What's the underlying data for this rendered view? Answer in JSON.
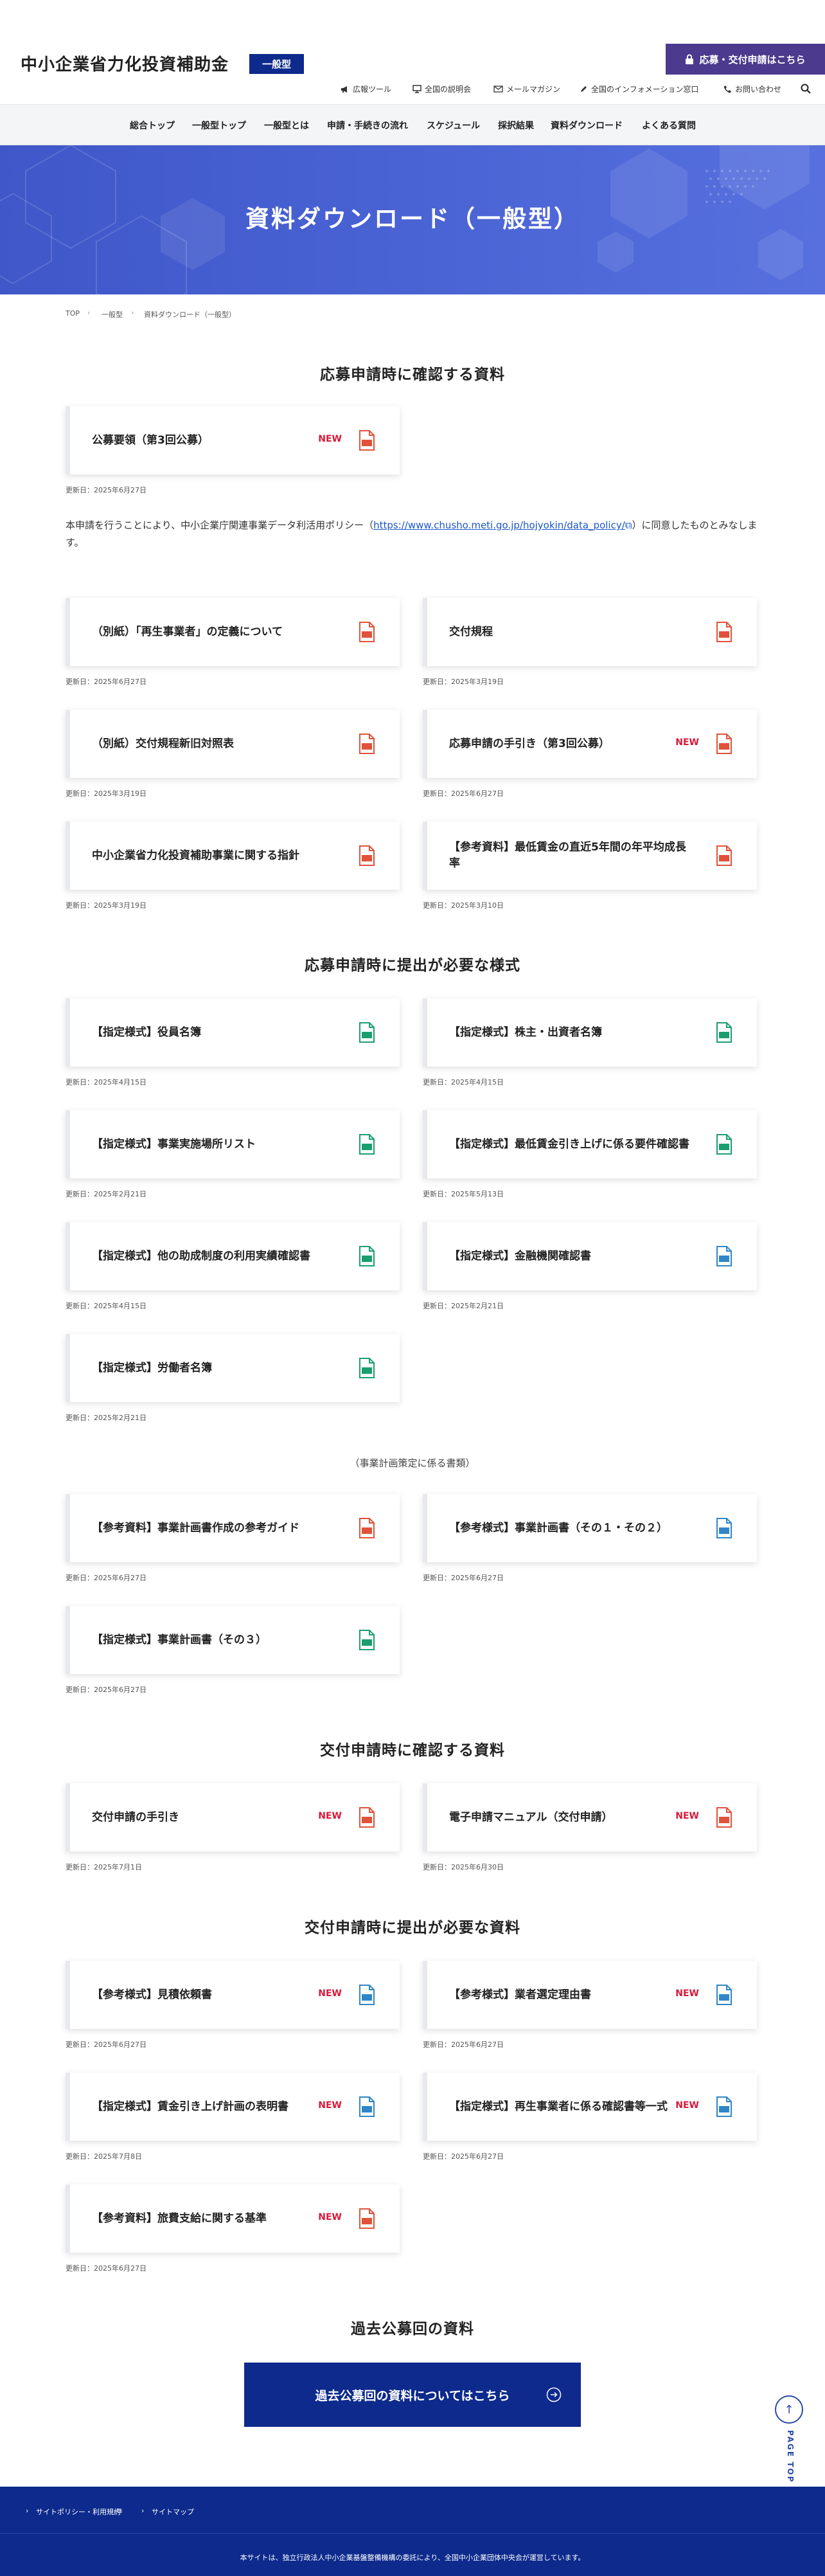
{
  "header": {
    "site_title": "中小企業省力化投資補助金",
    "badge": "一般型",
    "apply_button": "応募・交付申請はこちら",
    "utility": [
      {
        "label": "広報ツール",
        "icon": "megaphone-icon"
      },
      {
        "label": "全国の説明会",
        "icon": "presentation-icon"
      },
      {
        "label": "メールマガジン",
        "icon": "mail-icon"
      },
      {
        "label": "全国のインフォメーション窓口",
        "icon": "pen-icon"
      },
      {
        "label": "お問い合わせ",
        "icon": "phone-icon"
      }
    ],
    "nav": [
      "総合トップ",
      "一般型トップ",
      "一般型とは",
      "申請・手続きの流れ",
      "スケジュール",
      "採択結果",
      "資料ダウンロード",
      "よくある質問"
    ]
  },
  "hero": {
    "title": "資料ダウンロード（一般型）"
  },
  "breadcrumb": [
    "TOP",
    "一般型",
    "資料ダウンロード（一般型）"
  ],
  "colors": {
    "brand": "#0d2a8c",
    "apply": "#4b3a8d",
    "new": "#d8193b",
    "pdf": "#e0523a",
    "excel": "#1a9e6e",
    "word": "#2f86c8",
    "hero": "#4a63d4"
  },
  "new_label": "NEW",
  "sections": [
    {
      "heading": "応募申請時に確認する資料"
    },
    {
      "heading": "応募申請時に提出が必要な様式",
      "subheading": "（事業計画策定に係る書類）"
    },
    {
      "heading": "交付申請時に確認する資料"
    },
    {
      "heading": "交付申請時に提出が必要な資料"
    },
    {
      "heading": "過去公募回の資料"
    }
  ],
  "policy": {
    "before": "本申請を行うことにより、中小企業庁関連事業データ利活用ポリシー（",
    "link": "https://www.chusho.meti.go.jp/hojyokin/data_policy/",
    "after": "）に同意したものとみなします。"
  },
  "cards": [
    {
      "title": "公募要領（第3回公募）",
      "date": "更新日：2025年6月27日",
      "new": true,
      "file": "pdf"
    },
    {
      "title": "（別紙）「再生事業者」の定義について",
      "date": "更新日：2025年6月27日",
      "new": false,
      "file": "pdf"
    },
    {
      "title": "交付規程",
      "date": "更新日：2025年3月19日",
      "new": false,
      "file": "pdf"
    },
    {
      "title": "（別紙）交付規程新旧対照表",
      "date": "更新日：2025年3月19日",
      "new": false,
      "file": "pdf"
    },
    {
      "title": "応募申請の手引き（第3回公募）",
      "date": "更新日：2025年6月27日",
      "new": true,
      "file": "pdf"
    },
    {
      "title": "中小企業省力化投資補助事業に関する指針",
      "date": "更新日：2025年3月19日",
      "new": false,
      "file": "pdf"
    },
    {
      "title": "【参考資料】最低賃金の直近5年間の年平均成長率",
      "date": "更新日：2025年3月10日",
      "new": false,
      "file": "pdf"
    },
    {
      "title": "【指定様式】役員名簿",
      "date": "更新日：2025年4月15日",
      "new": false,
      "file": "excel"
    },
    {
      "title": "【指定様式】株主・出資者名簿",
      "date": "更新日：2025年4月15日",
      "new": false,
      "file": "excel"
    },
    {
      "title": "【指定様式】事業実施場所リスト",
      "date": "更新日：2025年2月21日",
      "new": false,
      "file": "excel"
    },
    {
      "title": "【指定様式】最低賃金引き上げに係る要件確認書",
      "date": "更新日：2025年5月13日",
      "new": false,
      "file": "excel"
    },
    {
      "title": "【指定様式】他の助成制度の利用実績確認書",
      "date": "更新日：2025年4月15日",
      "new": false,
      "file": "excel"
    },
    {
      "title": "【指定様式】金融機関確認書",
      "date": "更新日：2025年2月21日",
      "new": false,
      "file": "word"
    },
    {
      "title": "【指定様式】労働者名簿",
      "date": "更新日：2025年2月21日",
      "new": false,
      "file": "excel"
    },
    {
      "title": "【参考資料】事業計画書作成の参考ガイド",
      "date": "更新日：2025年6月27日",
      "new": false,
      "file": "pdf"
    },
    {
      "title": "【参考様式】事業計画書（その１・その２）",
      "date": "更新日：2025年6月27日",
      "new": false,
      "file": "word"
    },
    {
      "title": "【指定様式】事業計画書（その３）",
      "date": "更新日：2025年6月27日",
      "new": false,
      "file": "excel"
    },
    {
      "title": "交付申請の手引き",
      "date": "更新日：2025年7月1日",
      "new": true,
      "file": "pdf"
    },
    {
      "title": "電子申請マニュアル（交付申請）",
      "date": "更新日：2025年6月30日",
      "new": true,
      "file": "pdf"
    },
    {
      "title": "【参考様式】見積依頼書",
      "date": "更新日：2025年6月27日",
      "new": true,
      "file": "word"
    },
    {
      "title": "【参考様式】業者選定理由書",
      "date": "更新日：2025年6月27日",
      "new": true,
      "file": "word"
    },
    {
      "title": "【指定様式】賃金引き上げ計画の表明書",
      "date": "更新日：2025年7月8日",
      "new": true,
      "file": "word"
    },
    {
      "title": "【指定様式】再生事業者に係る確認書等一式",
      "date": "更新日：2025年6月27日",
      "new": true,
      "file": "word"
    },
    {
      "title": "【参考資料】旅費支給に関する基準",
      "date": "更新日：2025年6月27日",
      "new": true,
      "file": "pdf"
    }
  ],
  "past_button": "過去公募回の資料についてはこちら",
  "page_top": "PAGE TOP",
  "footer": {
    "links": [
      "サイトポリシー・利用規約",
      "サイトマップ"
    ],
    "note": "本サイトは、独立行政法人中小企業基盤整備機構の委託により、全国中小企業団体中央会が運営しています。"
  }
}
